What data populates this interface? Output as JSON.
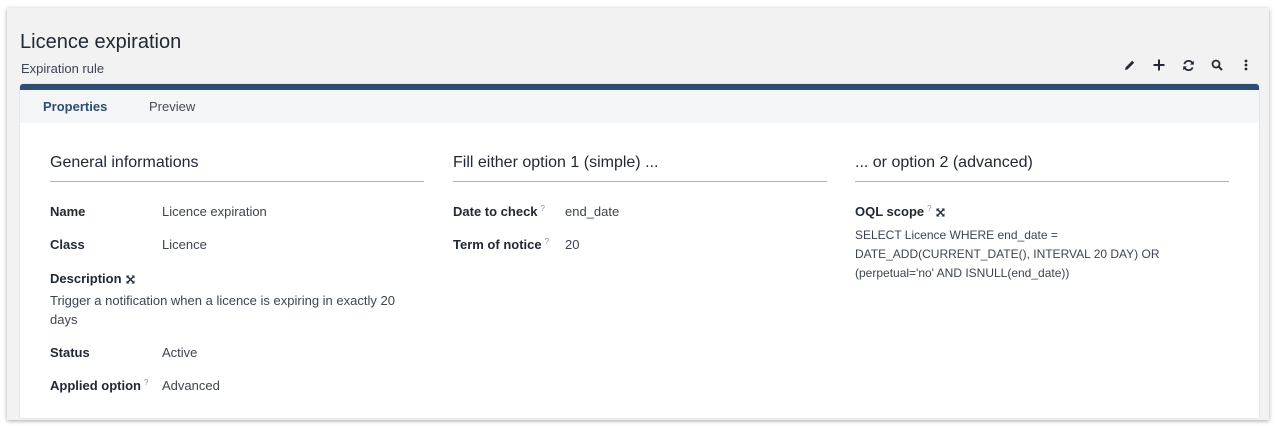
{
  "header": {
    "title": "Licence expiration",
    "subtitle": "Expiration rule"
  },
  "toolbar": {
    "icons": [
      "pencil-icon",
      "plus-icon",
      "refresh-icon",
      "search-icon",
      "more-vertical-icon"
    ]
  },
  "tabs": [
    {
      "label": "Properties",
      "active": true
    },
    {
      "label": "Preview",
      "active": false
    }
  ],
  "general": {
    "title": "General informations",
    "name_label": "Name",
    "name_value": "Licence expiration",
    "class_label": "Class",
    "class_value": "Licence",
    "description_label": "Description",
    "description_value": "Trigger a notification when a licence is expiring in exactly 20 days",
    "status_label": "Status",
    "status_value": "Active",
    "applied_label": "Applied option",
    "applied_value": "Advanced"
  },
  "option1": {
    "title": "Fill either option 1 (simple) ...",
    "date_label": "Date to check",
    "date_value": "end_date",
    "term_label": "Term of notice",
    "term_value": "20"
  },
  "option2": {
    "title": "... or option 2 (advanced)",
    "oql_label": "OQL scope",
    "oql_line1": "SELECT Licence WHERE end_date =",
    "oql_line2": "DATE_ADD(CURRENT_DATE(), INTERVAL 20 DAY) OR",
    "oql_line3": "(perpetual='no' AND ISNULL(end_date))"
  },
  "hint_mark": "?",
  "colors": {
    "accent": "#2f4e74",
    "background": "#f2f2f2",
    "text": "#212934"
  }
}
